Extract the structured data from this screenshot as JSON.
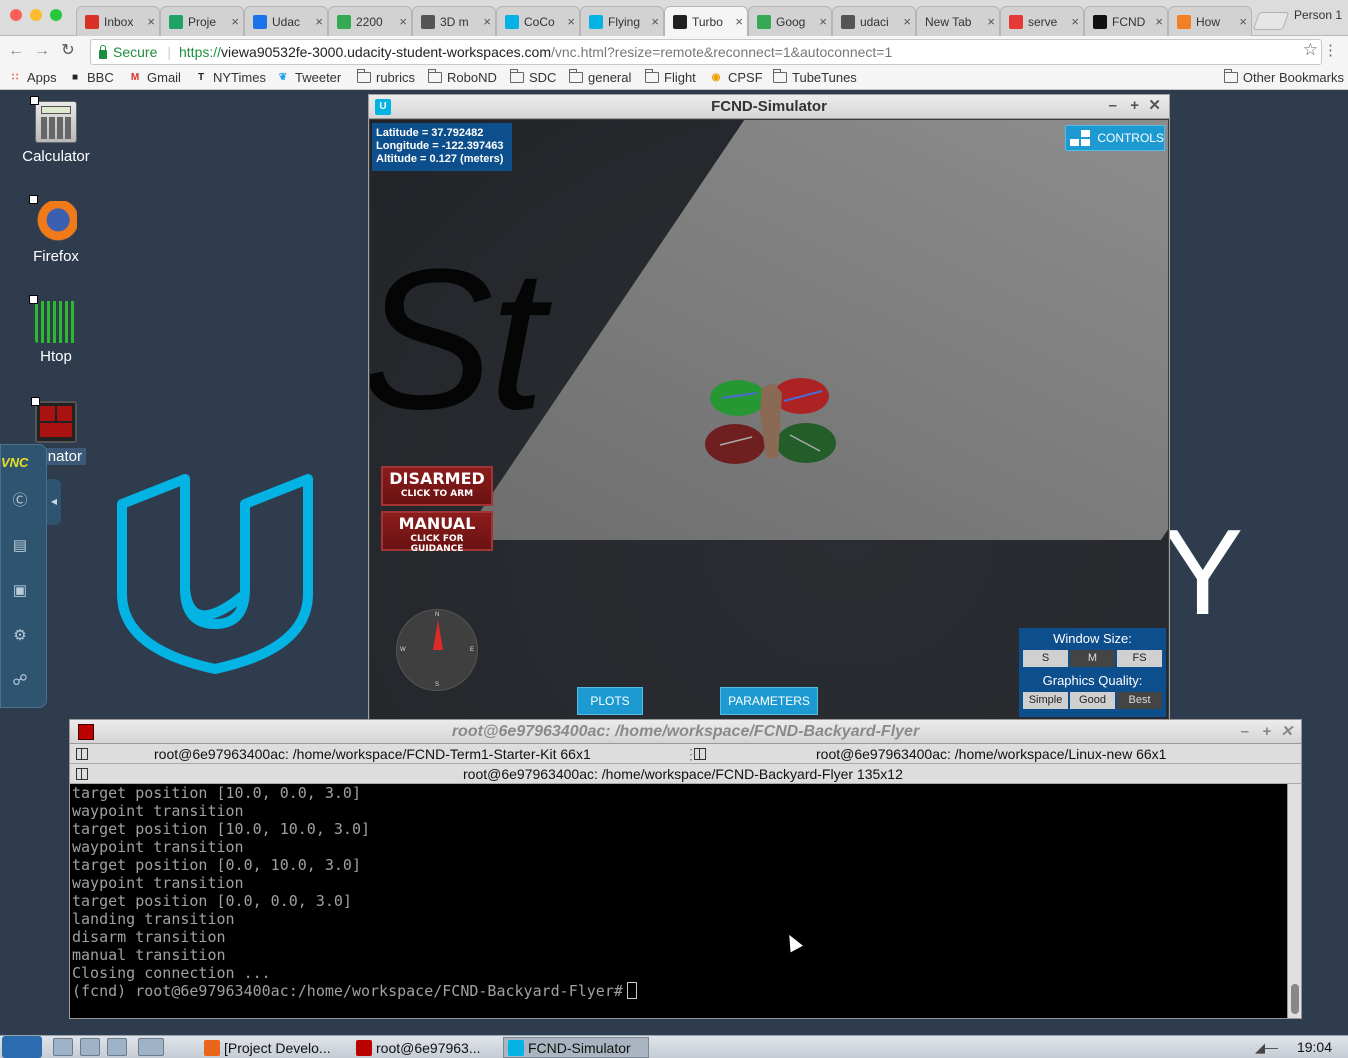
{
  "browser": {
    "tabs": [
      {
        "label": "Inbox",
        "icon": "gmail-icon",
        "color": "#d93025"
      },
      {
        "label": "Proje",
        "icon": "google-drive-icon",
        "color": "#1fa463"
      },
      {
        "label": "Udac",
        "icon": "calendar-icon",
        "color": "#1a73e8"
      },
      {
        "label": "2200",
        "icon": "google-maps-icon",
        "color": "#34a853"
      },
      {
        "label": "3D m",
        "icon": "generic-site-icon",
        "color": "#555555"
      },
      {
        "label": "CoCo",
        "icon": "udacity-icon",
        "color": "#02b3e4"
      },
      {
        "label": "Flying",
        "icon": "udacity-icon",
        "color": "#02b3e4"
      },
      {
        "label": "Turbo",
        "icon": "vnc-icon",
        "color": "#222222"
      },
      {
        "label": "Goog",
        "icon": "google-maps-icon",
        "color": "#34a853"
      },
      {
        "label": "udaci",
        "icon": "generic-site-icon",
        "color": "#555555"
      },
      {
        "label": "New Tab",
        "icon": "",
        "color": ""
      },
      {
        "label": "serve",
        "icon": "ask-icon",
        "color": "#e53935"
      },
      {
        "label": "FCND",
        "icon": "github-icon",
        "color": "#111111"
      },
      {
        "label": "How",
        "icon": "stackoverflow-icon",
        "color": "#f48024"
      }
    ],
    "active_tab_index": 7,
    "profile": "Person 1",
    "secure_label": "Secure",
    "url_scheme": "https://",
    "url_host": "viewa90532fe-3000.udacity-student-workspaces.com",
    "url_path": "/vnc.html?resize=remote&reconnect=1&autoconnect=1",
    "bookmarks": [
      {
        "label": "Apps",
        "icon": "apps-grid-icon"
      },
      {
        "label": "BBC",
        "icon": "bbc-icon"
      },
      {
        "label": "Gmail",
        "icon": "gmail-icon"
      },
      {
        "label": "NYTimes",
        "icon": "nytimes-icon"
      },
      {
        "label": "Tweeter",
        "icon": "twitter-icon"
      },
      {
        "label": "rubrics",
        "icon": "folder-icon"
      },
      {
        "label": "RoboND",
        "icon": "folder-icon"
      },
      {
        "label": "SDC",
        "icon": "folder-icon"
      },
      {
        "label": "general",
        "icon": "folder-icon"
      },
      {
        "label": "Flight",
        "icon": "folder-icon"
      },
      {
        "label": "CPSF",
        "icon": "cpsf-icon"
      },
      {
        "label": "TubeTunes",
        "icon": "folder-icon"
      }
    ],
    "other_bookmarks": "Other Bookmarks"
  },
  "desktop": {
    "icons": [
      {
        "label": "Calculator",
        "icon": "calculator-icon"
      },
      {
        "label": "Firefox",
        "icon": "firefox-icon"
      },
      {
        "label": "Htop",
        "icon": "htop-icon"
      },
      {
        "label": "Terminator",
        "icon": "terminator-icon"
      }
    ],
    "terminator_visible_label": "inator",
    "vnc_logo": "VNC",
    "vnc_buttons": [
      "keyboard-icon",
      "clipboard-icon",
      "fullscreen-icon",
      "settings-gear-icon",
      "disconnect-icon"
    ],
    "wallpaper_letter": "Y"
  },
  "simulator": {
    "title": "FCND-Simulator",
    "latitude": "Latitude = 37.792482",
    "longitude": "Longitude = -122.397463",
    "altitude": "Altitude = 0.127 (meters)",
    "controls_label": "CONTROLS",
    "ground_text": "St",
    "armed_title": "DISARMED",
    "armed_hint": "CLICK TO ARM",
    "mode_title": "MANUAL",
    "mode_hint": "CLICK FOR GUIDANCE",
    "compass": {
      "n": "N",
      "e": "E",
      "s": "S",
      "w": "W"
    },
    "plots_label": "PLOTS",
    "parameters_label": "PARAMETERS",
    "window_size_label": "Window Size:",
    "window_sizes": [
      "S",
      "M",
      "FS"
    ],
    "window_size_selected": "M",
    "graphics_label": "Graphics Quality:",
    "graphics_options": [
      "Simple",
      "Good",
      "Best"
    ],
    "graphics_selected": "Best"
  },
  "terminal": {
    "title": "root@6e97963400ac: /home/workspace/FCND-Backyard-Flyer",
    "group1": "root@6e97963400ac: /home/workspace/FCND-Term1-Starter-Kit 66x1",
    "group2": "root@6e97963400ac: /home/workspace/Linux-new 66x1",
    "group3": "root@6e97963400ac: /home/workspace/FCND-Backyard-Flyer 135x12",
    "lines": [
      "target position [10.0, 0.0, 3.0]",
      "waypoint transition",
      "target position [10.0, 10.0, 3.0]",
      "waypoint transition",
      "target position [0.0, 10.0, 3.0]",
      "waypoint transition",
      "target position [0.0, 0.0, 3.0]",
      "landing transition",
      "disarm transition",
      "manual transition",
      "Closing connection ..."
    ],
    "prompt": "(fcnd) root@6e97963400ac:/home/workspace/FCND-Backyard-Flyer#"
  },
  "taskbar": {
    "tasks": [
      {
        "label": "[Project Develo...",
        "icon": "firefox-icon"
      },
      {
        "label": "root@6e97963...",
        "icon": "terminator-icon"
      },
      {
        "label": "FCND-Simulator",
        "icon": "udacity-icon"
      }
    ],
    "clock": "19:04"
  },
  "colors": {
    "udacity_blue": "#02b3e4",
    "sim_panel_blue": "#0d4f8c",
    "sim_button_blue": "#1c9ad1",
    "disarmed_red": "#8b1c1c",
    "desktop_bg": "#2e3c4e"
  }
}
